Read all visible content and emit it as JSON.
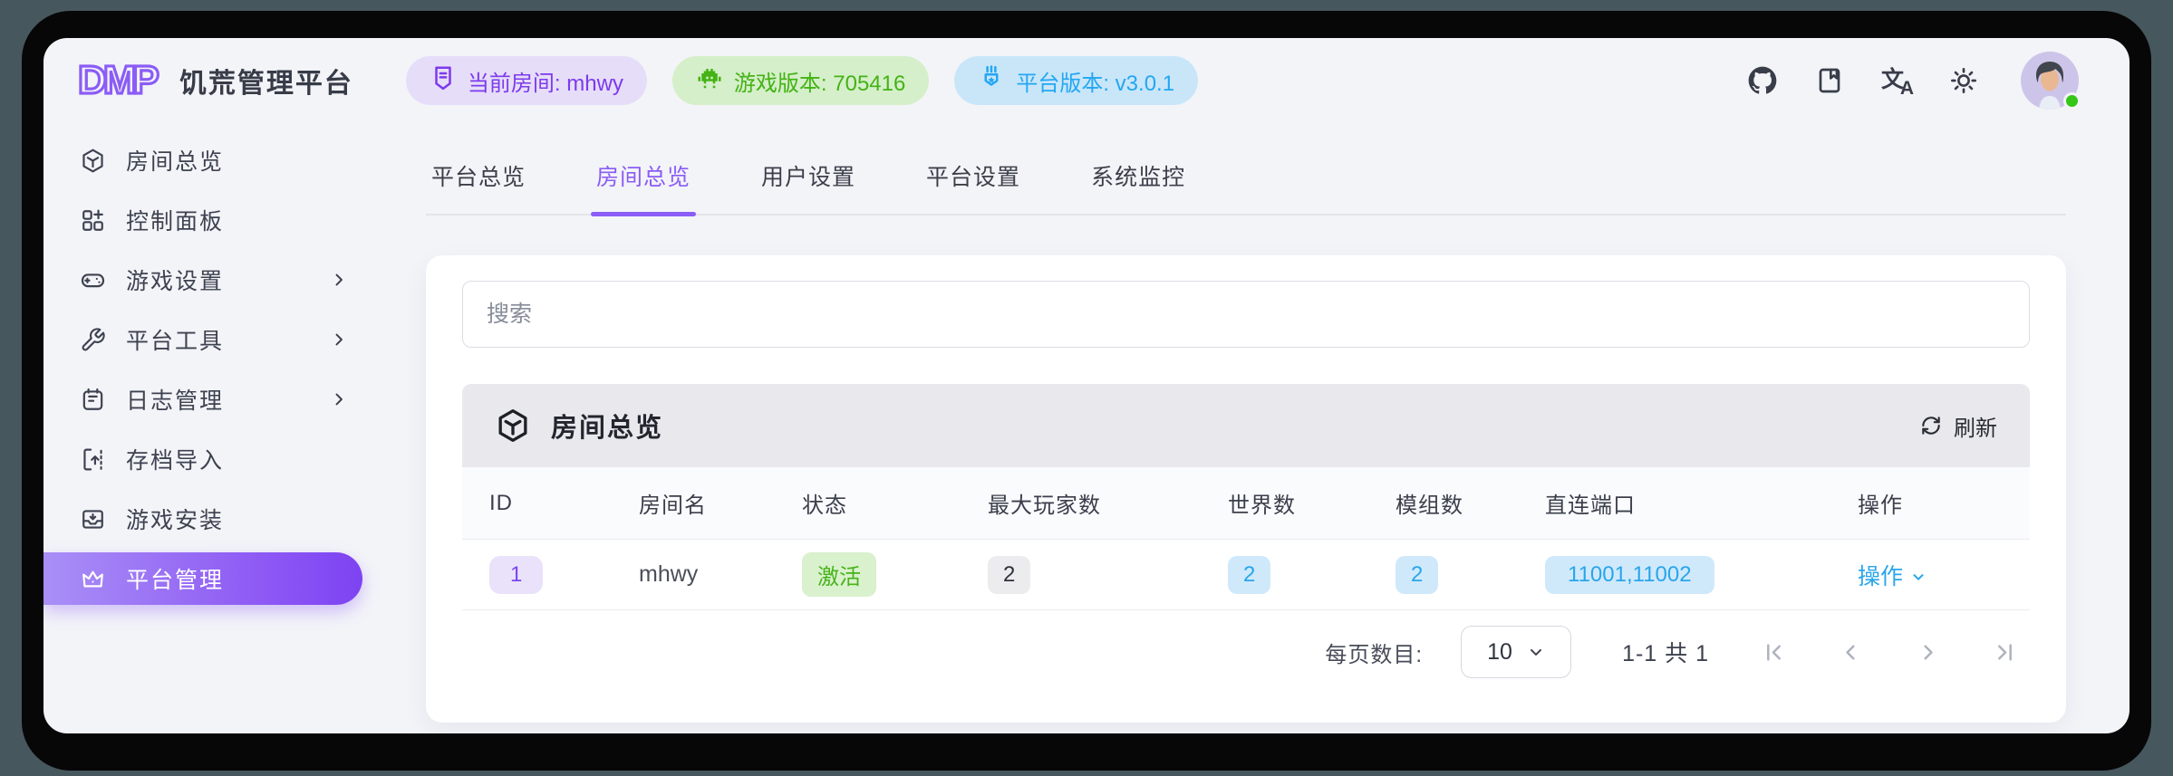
{
  "app": {
    "logo": "DMP",
    "title": "饥荒管理平台"
  },
  "header": {
    "badges": [
      {
        "icon": "room-badge-icon",
        "label": "当前房间: mhwy",
        "color": "purple"
      },
      {
        "icon": "game-version-icon",
        "label": "游戏版本: 705416",
        "color": "green"
      },
      {
        "icon": "platform-version-icon",
        "label": "平台版本: v3.0.1",
        "color": "blue"
      }
    ],
    "translate_icon_zh": "文",
    "translate_icon_en": "A",
    "action_icons": [
      "github-icon",
      "docs-icon",
      "translate-icon",
      "theme-icon"
    ],
    "avatar_status": "online"
  },
  "sidebar": {
    "items": [
      {
        "label": "房间总览",
        "icon": "cube-icon",
        "expandable": false,
        "active": false
      },
      {
        "label": "控制面板",
        "icon": "dashboard-icon",
        "expandable": false,
        "active": false
      },
      {
        "label": "游戏设置",
        "icon": "gamepad-icon",
        "expandable": true,
        "active": false
      },
      {
        "label": "平台工具",
        "icon": "wrench-icon",
        "expandable": true,
        "active": false
      },
      {
        "label": "日志管理",
        "icon": "log-icon",
        "expandable": true,
        "active": false
      },
      {
        "label": "存档导入",
        "icon": "import-icon",
        "expandable": false,
        "active": false
      },
      {
        "label": "游戏安装",
        "icon": "install-icon",
        "expandable": false,
        "active": false
      },
      {
        "label": "平台管理",
        "icon": "crown-icon",
        "expandable": false,
        "active": true
      }
    ]
  },
  "tabs": [
    {
      "label": "平台总览",
      "active": false
    },
    {
      "label": "房间总览",
      "active": true
    },
    {
      "label": "用户设置",
      "active": false
    },
    {
      "label": "平台设置",
      "active": false
    },
    {
      "label": "系统监控",
      "active": false
    }
  ],
  "search": {
    "placeholder": "搜索"
  },
  "table": {
    "title": "房间总览",
    "title_icon": "cube-icon",
    "refresh_label": "刷新",
    "columns": [
      "ID",
      "房间名",
      "状态",
      "最大玩家数",
      "世界数",
      "模组数",
      "直连端口",
      "操作"
    ],
    "rows": [
      {
        "id": "1",
        "name": "mhwy",
        "status": "激活",
        "max_players": "2",
        "worlds": "2",
        "mods": "2",
        "ports": "11001,11002",
        "action": "操作"
      }
    ]
  },
  "pagination": {
    "per_page_label": "每页数目:",
    "per_page": "10",
    "range_label": "1-1 共 1",
    "pager_icons": [
      "first-page-icon",
      "prev-page-icon",
      "next-page-icon",
      "last-page-icon"
    ]
  },
  "colors": {
    "accent": "#8b5cf6",
    "badge_purple_text": "#7c3aed",
    "badge_green_text": "#44b315",
    "badge_blue_text": "#23a7f2",
    "status_online": "#35c716"
  }
}
